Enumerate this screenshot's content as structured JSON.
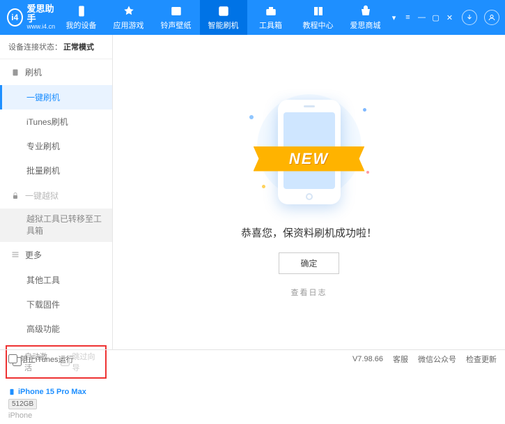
{
  "header": {
    "logo_title": "爱思助手",
    "logo_url": "www.i4.cn",
    "tabs": [
      {
        "label": "我的设备"
      },
      {
        "label": "应用游戏"
      },
      {
        "label": "铃声壁纸"
      },
      {
        "label": "智能刷机",
        "active": true
      },
      {
        "label": "工具箱"
      },
      {
        "label": "教程中心"
      },
      {
        "label": "爱思商城"
      }
    ]
  },
  "status": {
    "label": "设备连接状态：",
    "value": "正常模式"
  },
  "sidebar": {
    "group_flash": "刷机",
    "items_flash": [
      {
        "label": "一键刷机",
        "active": true
      },
      {
        "label": "iTunes刷机"
      },
      {
        "label": "专业刷机"
      },
      {
        "label": "批量刷机"
      }
    ],
    "group_jailbreak": "一键越狱",
    "jailbreak_moved": "越狱工具已转移至工具箱",
    "group_more": "更多",
    "items_more": [
      {
        "label": "其他工具"
      },
      {
        "label": "下载固件"
      },
      {
        "label": "高级功能"
      }
    ],
    "checkbox_auto": "自动激活",
    "checkbox_skip": "跳过向导"
  },
  "device": {
    "name": "iPhone 15 Pro Max",
    "storage": "512GB",
    "type": "iPhone"
  },
  "main": {
    "banner_text": "NEW",
    "message": "恭喜您，保资料刷机成功啦！",
    "ok_button": "确定",
    "view_log": "查看日志"
  },
  "footer": {
    "block_itunes": "阻止iTunes运行",
    "version": "V7.98.66",
    "links": [
      "客服",
      "微信公众号",
      "检查更新"
    ]
  }
}
